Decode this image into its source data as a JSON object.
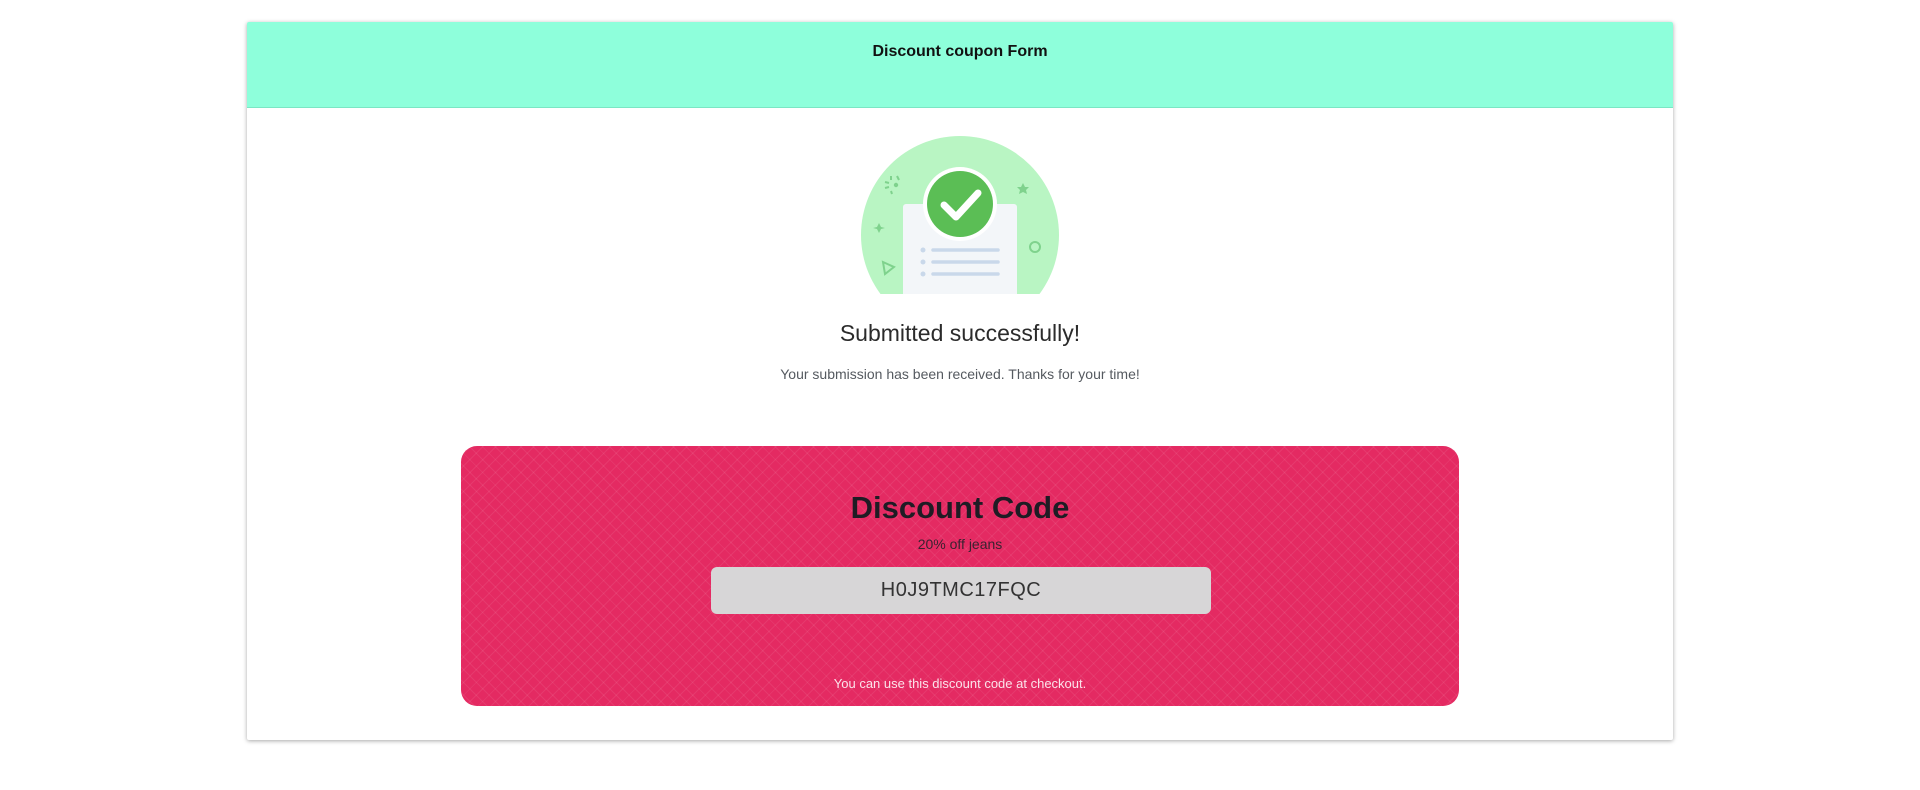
{
  "header": {
    "title": "Discount coupon Form",
    "background": "#8effdb"
  },
  "illustration": {
    "icon": "success-check-document-icon",
    "accent": "#5bbe55"
  },
  "confirmation": {
    "title": "Submitted successfully!",
    "message": "Your submission has been received. Thanks for your time!"
  },
  "coupon": {
    "title": "Discount Code",
    "subtitle": "20% off jeans",
    "code": "H0J9TMC17FQC",
    "note": "You can use this discount code at checkout.",
    "background": "#e42a62"
  }
}
